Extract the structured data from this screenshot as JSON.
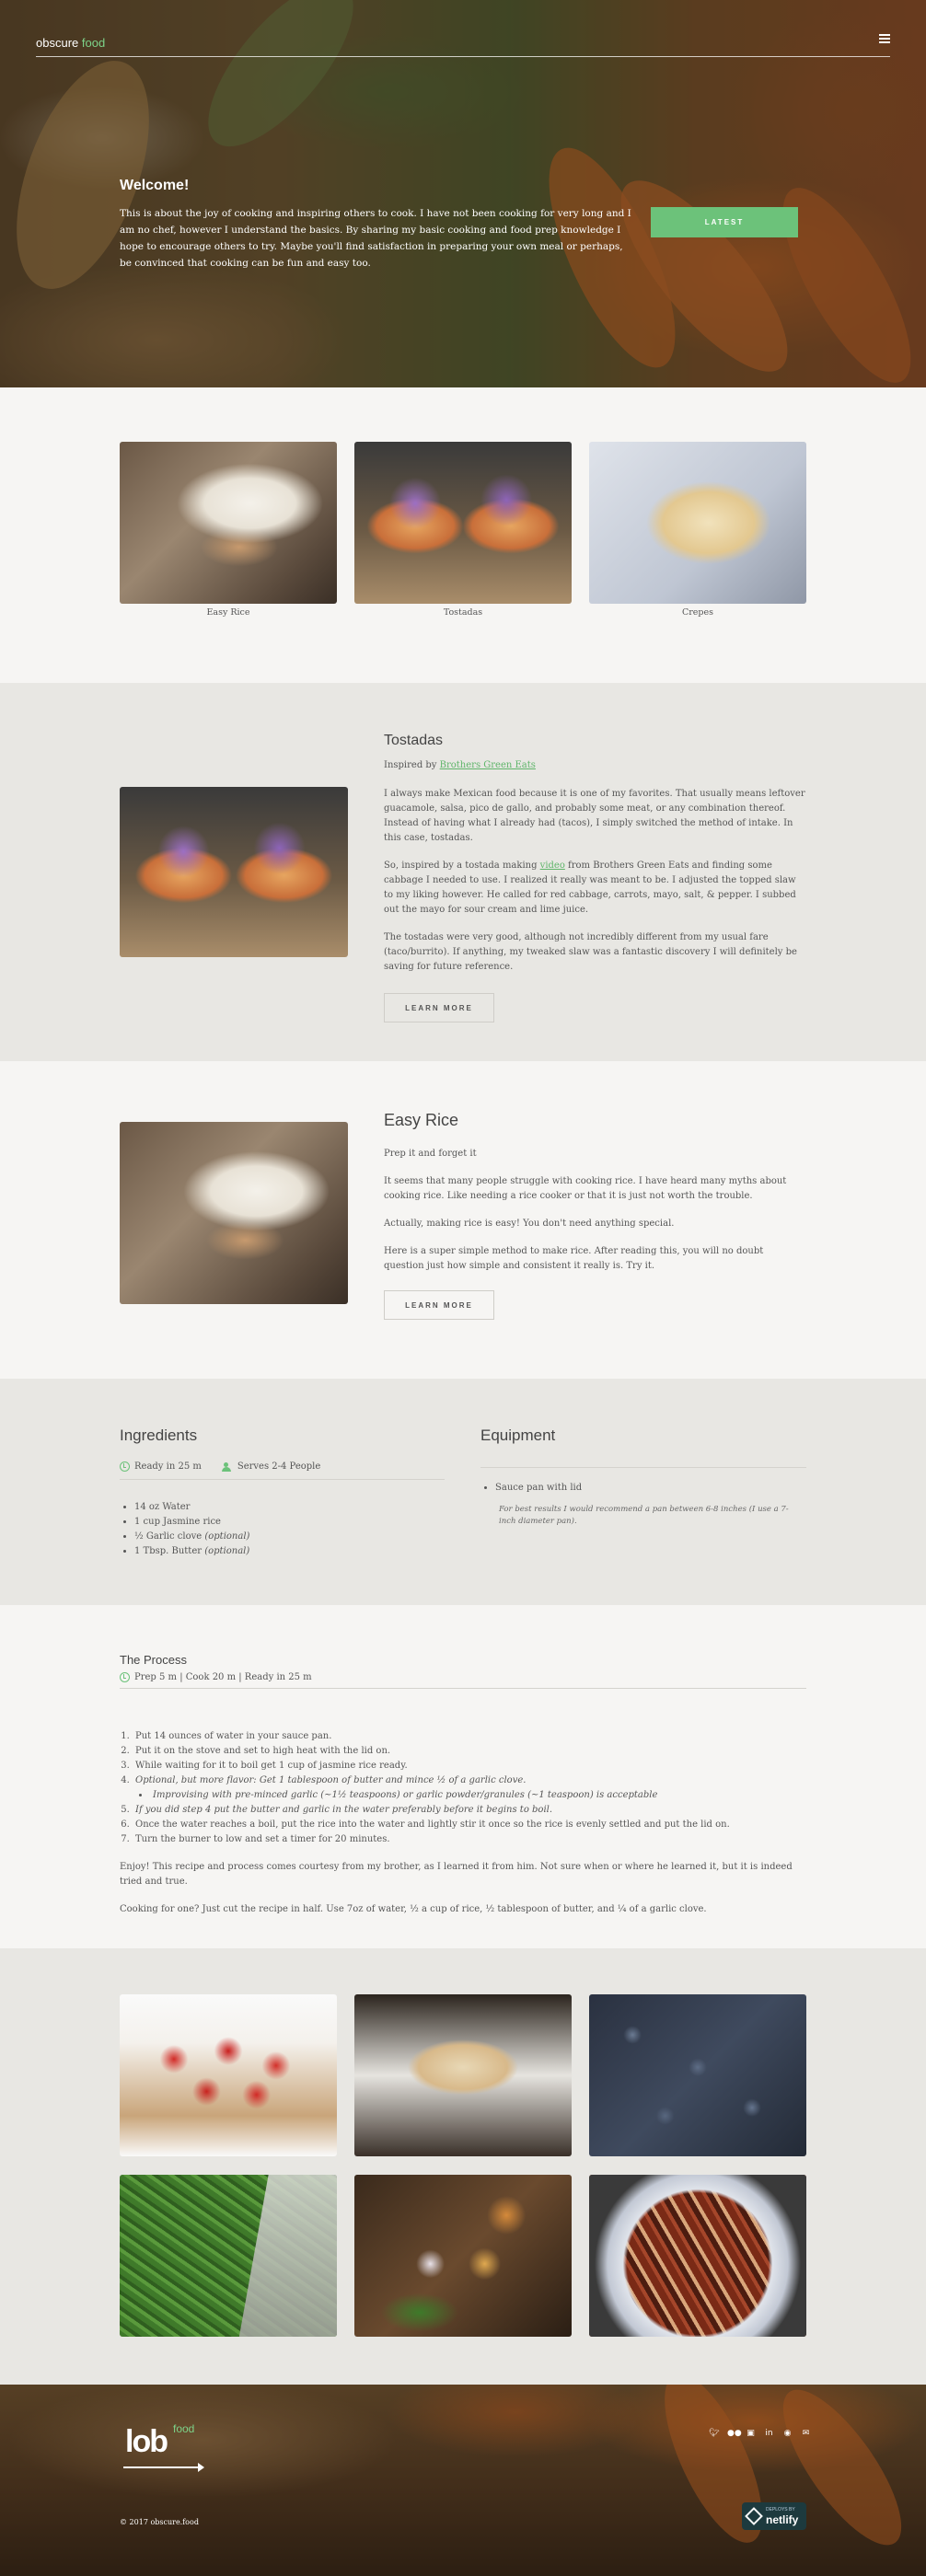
{
  "brand": {
    "name": "obscure",
    "accent": "food"
  },
  "header": {
    "menu_icon": "hamburger-icon"
  },
  "hero": {
    "title": "Welcome!",
    "text": "This is about the joy of cooking and inspiring others to cook. I have not been cooking for very long and I am no chef, however I understand the basics. By sharing my basic cooking and food prep knowledge I hope to encourage others to try. Maybe you'll find satisfaction in preparing your own meal or perhaps, be convinced that cooking can be fun and easy too.",
    "button": "LATEST"
  },
  "gallery": [
    {
      "caption": "Easy Rice"
    },
    {
      "caption": "Tostadas"
    },
    {
      "caption": "Crepes"
    }
  ],
  "tostadas": {
    "title": "Tostadas",
    "inspired_prefix": "Inspired by",
    "inspired_link": "Brothers Green Eats",
    "p1": "I always make Mexican food because it is one of my favorites. That usually means leftover guacamole, salsa, pico de gallo, and probably some meat, or any combination thereof. Instead of having what I already had (tacos), I simply switched the method of intake. In this case, tostadas.",
    "p2_before": "So, inspired by a tostada making",
    "p2_link": "video",
    "p2_after": "from Brothers Green Eats and finding some cabbage I needed to use. I realized it really was meant to be. I adjusted the topped slaw to my liking however. He called for red cabbage, carrots, mayo, salt, & pepper. I subbed out the mayo for sour cream and lime juice.",
    "p3": "The tostadas were very good, although not incredibly different from my usual fare (taco/burrito). If anything, my tweaked slaw was a fantastic discovery I will definitely be saving for future reference.",
    "button": "LEARN MORE"
  },
  "rice": {
    "title": "Easy Rice",
    "p1": "Prep it and forget it",
    "p2": "It seems that many people struggle with cooking rice. I have heard many myths about cooking rice. Like needing a rice cooker or that it is just not worth the trouble.",
    "p3": "Actually, making rice is easy! You don't need anything special.",
    "p4": "Here is a super simple method to make rice. After reading this, you will no doubt question just how simple and consistent it really is. Try it.",
    "button": "LEARN MORE"
  },
  "ingredients": {
    "title": "Ingredients",
    "ready": "Ready in 25 m",
    "serves": "Serves 2-4 People",
    "items": [
      "14 oz Water",
      "1 cup Jasmine rice",
      "½ Garlic clove",
      "1 Tbsp. Butter"
    ],
    "optional": "(optional)"
  },
  "equipment": {
    "title": "Equipment",
    "items": [
      "Sauce pan with lid"
    ],
    "note": "For best results I would recommend a pan between 6-8 inches (I use a 7-inch diameter pan)."
  },
  "process": {
    "title": "The Process",
    "meta": "Prep 5 m | Cook 20 m | Ready in 25 m",
    "steps": [
      "Put 14 ounces of water in your sauce pan.",
      "Put it on the stove and set to high heat with the lid on.",
      "While waiting for it to boil get 1 cup of jasmine rice ready.",
      "Optional, but more flavor: Get 1 tablespoon of butter and mince ½ of a garlic clove.",
      "Improvising with pre-minced garlic (~1½ teaspoons) or garlic powder/granules (~1 teaspoon) is acceptable",
      "If you did step 4 put the butter and garlic in the water preferably before it begins to boil.",
      "Once the water reaches a boil, put the rice into the water and lightly stir it once so the rice is evenly settled and put the lid on.",
      "Turn the burner to low and set a timer for 20 minutes."
    ],
    "p1": "Enjoy! This recipe and process comes courtesy from my brother, as I learned it from him. Not sure when or where he learned it, but it is indeed tried and true.",
    "p2": "Cooking for one? Just cut the recipe in half. Use 7oz of water, ½ a cup of rice, ½ tablespoon of butter, and ¼ of a garlic clove."
  },
  "footer": {
    "logo": "lob",
    "logo_accent": "food",
    "copyright": "© 2017 obscure.food",
    "socials": [
      "twitter-icon",
      "flickr-icon",
      "instagram-icon",
      "linkedin-icon",
      "github-icon",
      "email-icon"
    ],
    "badge_small": "DEPLOYS BY",
    "badge_big": "netlify"
  },
  "colors": {
    "accent": "#6cc27a",
    "section_alt": "#e8e7e3",
    "section": "#f6f5f3"
  }
}
